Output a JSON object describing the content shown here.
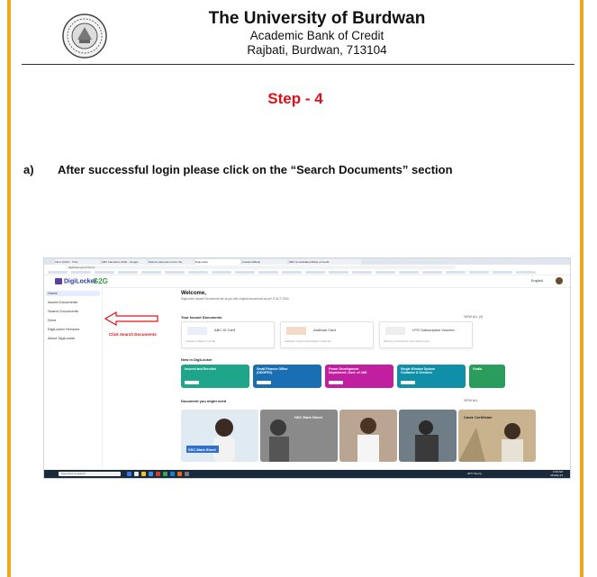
{
  "header": {
    "university": "The University of Burdwan",
    "department": "Academic Bank of Credit",
    "address": "Rajbati, Burdwan, 713104"
  },
  "step_title": "Step - 4",
  "instruction": {
    "label": "a)",
    "text": "After successful login please click on the “Search Documents” section"
  },
  "screenshot": {
    "tabs": [
      "Inbox (6/42) - 7/61)",
      "ABC Admission 2022 - Google",
      "Submit parameters from the",
      "DigiLocker",
      "AcademicBank",
      "ABC Consolidated Bank of Credit"
    ],
    "url": "digilocker.gov.in/home",
    "logo": "DigiLocker",
    "g2c": "G2G",
    "language": "English",
    "sidebar": {
      "items": [
        "Home",
        "Issued Documents",
        "Search Documents",
        "Drive",
        "DigiLocker Services",
        "About DigiLocker"
      ]
    },
    "annotation": "Click Search Documents",
    "welcome": "Welcome,",
    "welcome_sub": "DigiLocker Issued Documents are at par with original documents as per IT ACT 2000.",
    "issued_title": "Your Issued Documents",
    "view_all": "VIEW ALL (3)",
    "cards": [
      {
        "title": "ABC ID Card",
        "desc": "Academic Bank of Credit"
      },
      {
        "title": "Aadhaar Card",
        "desc": "Aadhaar Unique Identification Authority"
      },
      {
        "title": "LPG Subscription Voucher",
        "desc": "Ministry of Petroleum and Natural Gas"
      }
    ],
    "new_title": "New in DigiLocker",
    "promos": [
      {
        "title": "Insured and Enrolled",
        "color": "#1fa58a"
      },
      {
        "title": "Small Finance Office (ODOPEX)",
        "color": "#1a6fb3"
      },
      {
        "title": "Power Development Department, Govt. of J&K",
        "color": "#c21fa0"
      },
      {
        "title": "Single Window System Guidance & Services",
        "color": "#0f8fa8"
      },
      {
        "title": "Gudia",
        "color": "#2a9d5c"
      }
    ],
    "might_title": "Document you might need",
    "might_view": "VIEW ALL",
    "tiles": [
      {
        "label": "SSC Mark Sheet"
      },
      {
        "label": "HSC Mark Sheet"
      },
      {
        "label": ""
      },
      {
        "label": ""
      },
      {
        "label": "Caste Certificate"
      }
    ],
    "taskbar_search": "Type here to search",
    "weather": "30°C Sunny",
    "clock_time": "1:00 AM",
    "clock_date": "06-Mar-23"
  }
}
